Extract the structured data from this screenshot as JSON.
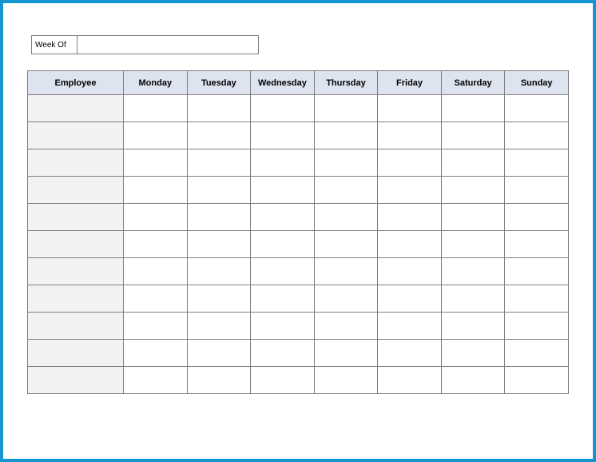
{
  "weekOf": {
    "label": "Week Of",
    "value": ""
  },
  "table": {
    "headers": [
      "Employee",
      "Monday",
      "Tuesday",
      "Wednesday",
      "Thursday",
      "Friday",
      "Saturday",
      "Sunday"
    ],
    "rows": [
      {
        "employee": "",
        "monday": "",
        "tuesday": "",
        "wednesday": "",
        "thursday": "",
        "friday": "",
        "saturday": "",
        "sunday": ""
      },
      {
        "employee": "",
        "monday": "",
        "tuesday": "",
        "wednesday": "",
        "thursday": "",
        "friday": "",
        "saturday": "",
        "sunday": ""
      },
      {
        "employee": "",
        "monday": "",
        "tuesday": "",
        "wednesday": "",
        "thursday": "",
        "friday": "",
        "saturday": "",
        "sunday": ""
      },
      {
        "employee": "",
        "monday": "",
        "tuesday": "",
        "wednesday": "",
        "thursday": "",
        "friday": "",
        "saturday": "",
        "sunday": ""
      },
      {
        "employee": "",
        "monday": "",
        "tuesday": "",
        "wednesday": "",
        "thursday": "",
        "friday": "",
        "saturday": "",
        "sunday": ""
      },
      {
        "employee": "",
        "monday": "",
        "tuesday": "",
        "wednesday": "",
        "thursday": "",
        "friday": "",
        "saturday": "",
        "sunday": ""
      },
      {
        "employee": "",
        "monday": "",
        "tuesday": "",
        "wednesday": "",
        "thursday": "",
        "friday": "",
        "saturday": "",
        "sunday": ""
      },
      {
        "employee": "",
        "monday": "",
        "tuesday": "",
        "wednesday": "",
        "thursday": "",
        "friday": "",
        "saturday": "",
        "sunday": ""
      },
      {
        "employee": "",
        "monday": "",
        "tuesday": "",
        "wednesday": "",
        "thursday": "",
        "friday": "",
        "saturday": "",
        "sunday": ""
      },
      {
        "employee": "",
        "monday": "",
        "tuesday": "",
        "wednesday": "",
        "thursday": "",
        "friday": "",
        "saturday": "",
        "sunday": ""
      },
      {
        "employee": "",
        "monday": "",
        "tuesday": "",
        "wednesday": "",
        "thursday": "",
        "friday": "",
        "saturday": "",
        "sunday": ""
      }
    ]
  }
}
